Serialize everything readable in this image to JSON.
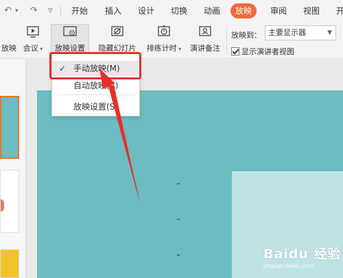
{
  "quick_access": {
    "undo_glyph": "↶",
    "redo_glyph": "↷",
    "more_glyph": "▿"
  },
  "tabs": [
    {
      "label": "开始",
      "active": false
    },
    {
      "label": "插入",
      "active": false
    },
    {
      "label": "设计",
      "active": false
    },
    {
      "label": "切换",
      "active": false
    },
    {
      "label": "动画",
      "active": false
    },
    {
      "label": "放映",
      "active": true
    },
    {
      "label": "审阅",
      "active": false
    },
    {
      "label": "视图",
      "active": false
    },
    {
      "label": "开",
      "active": false
    }
  ],
  "ribbon": {
    "play": "放映",
    "meeting": "会议",
    "slideshow_settings": "放映设置",
    "hide_slide": "隐藏幻灯片",
    "rehearse_timing": "排练计时",
    "speaker_notes": "演讲备注",
    "play_to_label": "放映到：",
    "play_to_value": "主要显示器",
    "presenter_view": "显示演讲者视图",
    "presenter_view_checked": true
  },
  "menu": {
    "items": [
      {
        "label": "手动放映(M)",
        "checked": true
      },
      {
        "label": "自动放映(A)",
        "checked": false
      },
      {
        "label": "放映设置(S)",
        "checked": false
      }
    ]
  },
  "colors": {
    "accent": "#ef6a3a",
    "slide_bg": "#6cbcc1",
    "annotation": "#e5312b"
  },
  "watermark": {
    "main": "Baidu 经验",
    "sub": "jingyan.baidu.com"
  }
}
